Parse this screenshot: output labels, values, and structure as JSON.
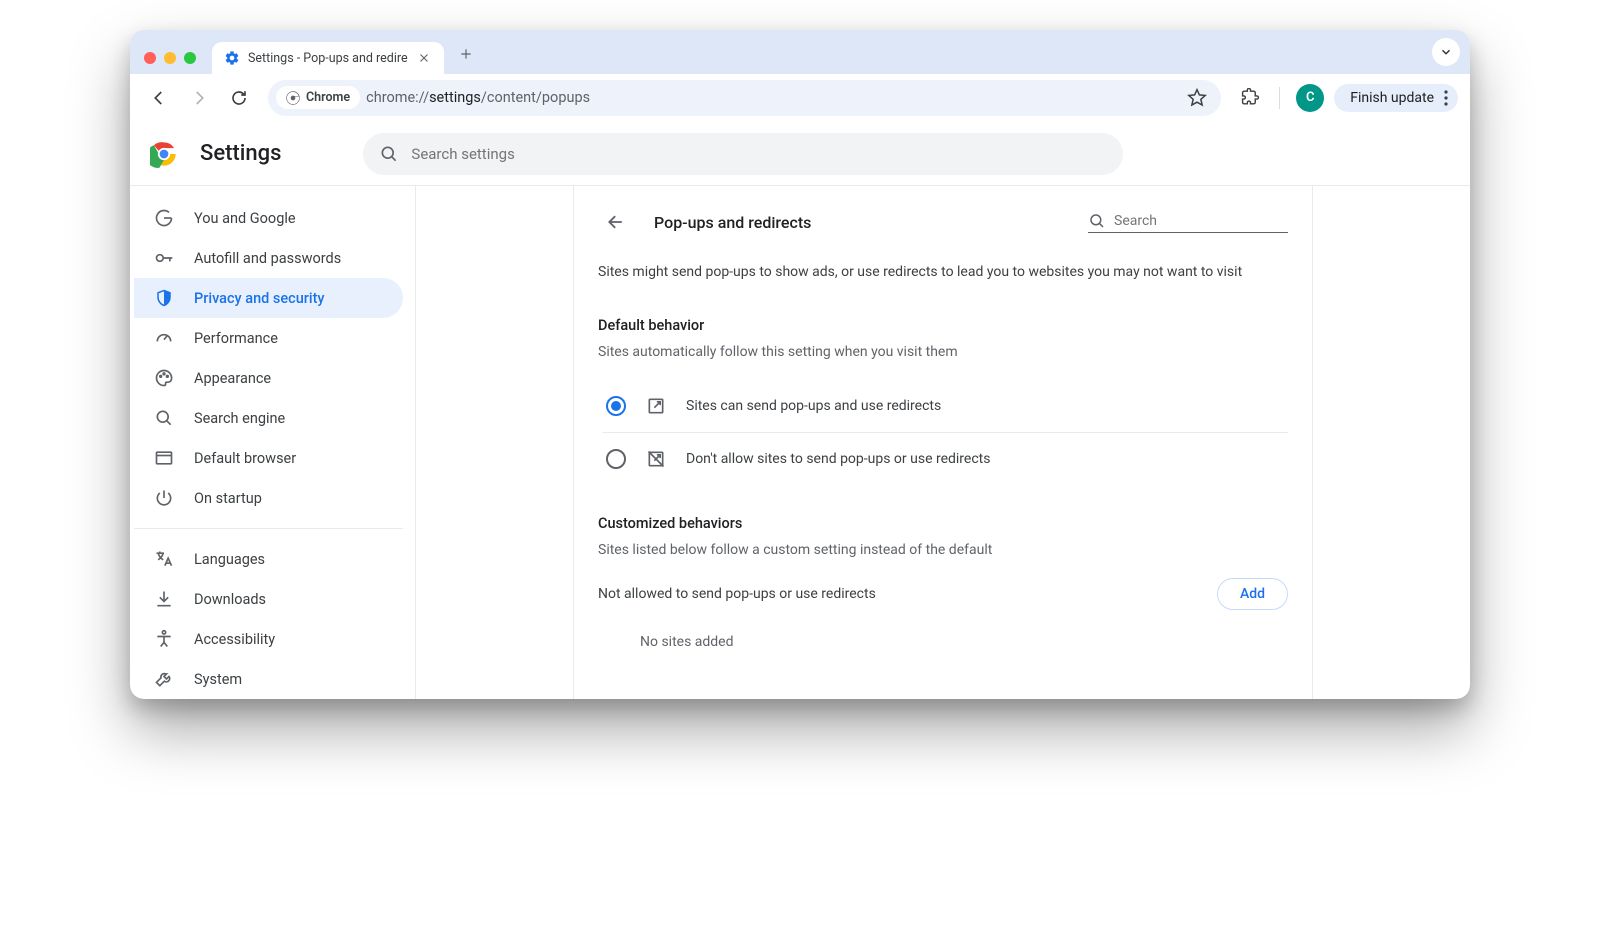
{
  "browser": {
    "tab_title": "Settings - Pop-ups and redire",
    "url_prefix": "chrome://",
    "url_bold": "settings",
    "url_suffix": "/content/popups",
    "chip_label": "Chrome",
    "finish_update": "Finish update",
    "avatar_letter": "C"
  },
  "header": {
    "title": "Settings",
    "search_placeholder": "Search settings"
  },
  "sidebar": {
    "items": [
      {
        "label": "You and Google"
      },
      {
        "label": "Autofill and passwords"
      },
      {
        "label": "Privacy and security"
      },
      {
        "label": "Performance"
      },
      {
        "label": "Appearance"
      },
      {
        "label": "Search engine"
      },
      {
        "label": "Default browser"
      },
      {
        "label": "On startup"
      }
    ],
    "items2": [
      {
        "label": "Languages"
      },
      {
        "label": "Downloads"
      },
      {
        "label": "Accessibility"
      },
      {
        "label": "System"
      }
    ]
  },
  "panel": {
    "title": "Pop-ups and redirects",
    "search_placeholder": "Search",
    "intro": "Sites might send pop-ups to show ads, or use redirects to lead you to websites you may not want to visit",
    "default_behavior_title": "Default behavior",
    "default_behavior_sub": "Sites automatically follow this setting when you visit them",
    "radio_allow": "Sites can send pop-ups and use redirects",
    "radio_block": "Don't allow sites to send pop-ups or use redirects",
    "custom_title": "Customized behaviors",
    "custom_sub": "Sites listed below follow a custom setting instead of the default",
    "not_allowed_label": "Not allowed to send pop-ups or use redirects",
    "add_button": "Add",
    "no_sites": "No sites added"
  }
}
